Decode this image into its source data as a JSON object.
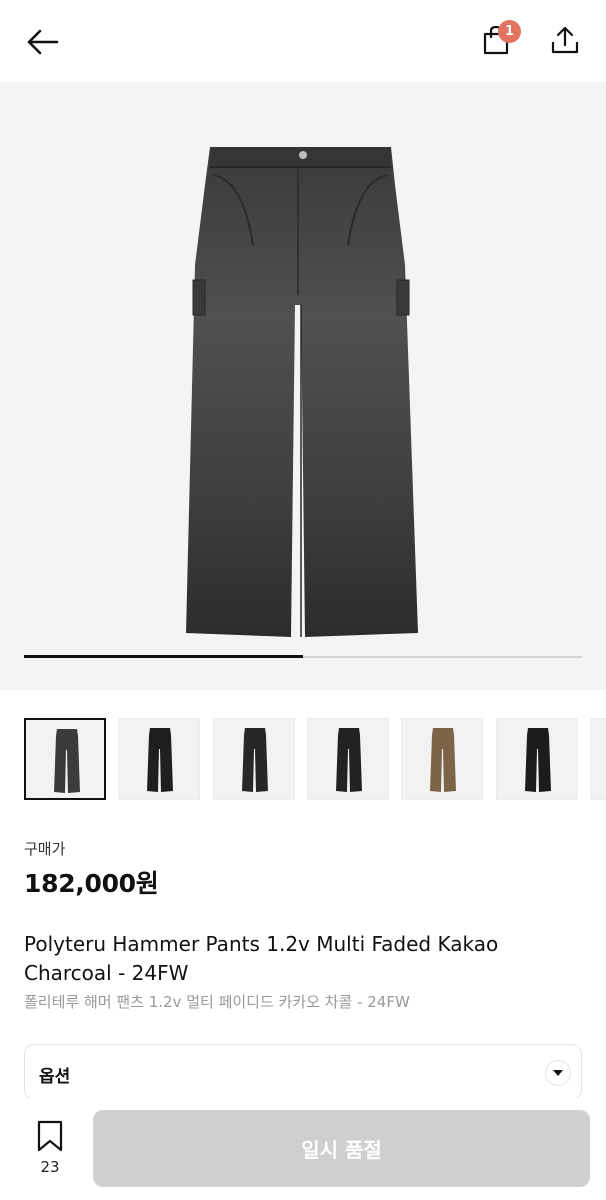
{
  "header": {
    "back_icon": "arrow-left-icon",
    "cart_icon": "shopping-bag-icon",
    "cart_badge": "1",
    "share_icon": "share-upload-icon",
    "badge_color": "#e1735f"
  },
  "gallery": {
    "image_progress": 0.5,
    "thumbnails": [
      {
        "color": "#3b3b3b",
        "selected": true
      },
      {
        "color": "#1f1f1f",
        "selected": false
      },
      {
        "color": "#262729",
        "selected": false
      },
      {
        "color": "#222222",
        "selected": false
      },
      {
        "color": "#7b6448",
        "selected": false
      },
      {
        "color": "#1c1c1c",
        "selected": false
      }
    ]
  },
  "product": {
    "price_label": "구매가",
    "price": "182,000원",
    "title_en": "Polyteru Hammer Pants 1.2v Multi Faded Kakao Charcoal - 24FW",
    "title_ko": "폴리테루 해머 팬츠 1.2v 멀티 페이디드 카카오 차콜 - 24FW"
  },
  "options": {
    "label": "옵션",
    "arrow_icon": "caret-down-icon"
  },
  "bottom": {
    "bookmark_icon": "bookmark-icon",
    "bookmark_count": "23",
    "soldout_label": "일시 품절",
    "soldout_bg": "#cfcfcf"
  }
}
